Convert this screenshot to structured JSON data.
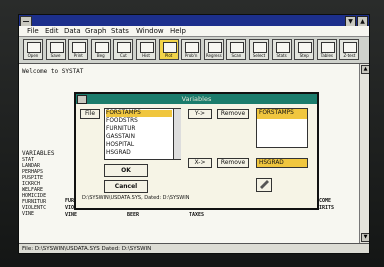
{
  "window": {
    "minimize_glyph": "▼",
    "maximize_glyph": "▲"
  },
  "menu": [
    "File",
    "Edit",
    "Data",
    "Graph",
    "Stats",
    "Window",
    "Help"
  ],
  "toolbar": [
    {
      "label": "Open"
    },
    {
      "label": "Save"
    },
    {
      "label": "Print"
    },
    {
      "label": "Beg"
    },
    {
      "label": "Cut"
    },
    {
      "label": "Hist"
    },
    {
      "label": "Plot"
    },
    {
      "label": "Prob'n"
    },
    {
      "label": "Regress"
    },
    {
      "label": "Scan"
    },
    {
      "label": "Select"
    },
    {
      "label": "Stats"
    },
    {
      "label": "Step"
    },
    {
      "label": "Tables"
    },
    {
      "label": "Z-test"
    }
  ],
  "toolbar_icons": [
    "open-icon",
    "save-icon",
    "print-icon",
    "begin-icon",
    "cut-icon",
    "histogram-icon",
    "scatter-plot-icon",
    "probability-icon",
    "regression-icon",
    "scan-icon",
    "select-icon",
    "statistics-icon",
    "step-icon",
    "tables-icon",
    "z-test-icon"
  ],
  "toolbar_active_index": 6,
  "main": {
    "welcome": "Welcome to SYSTAT",
    "variables_label": "VARIABLES",
    "left_vars": [
      "STAT",
      "LANDAR",
      "PERHAPS",
      "PUSPITE",
      "ICKRCH",
      "WELFARE",
      "HOMICIDE",
      "FURNITUR",
      "VIOLENTC",
      "VINE"
    ],
    "table_rows": [
      [
        "FURNITUR",
        "GASSTAIN",
        "HOSPITAL",
        "HSGRAD",
        "INCOME"
      ],
      [
        "VIOLENTC",
        "PROPERTY",
        "LOGNTS",
        "PRISONER",
        "SPIRITS"
      ],
      [
        "VINE",
        "BEER",
        "TAXES",
        "",
        ""
      ]
    ]
  },
  "dialog": {
    "title": "Variables",
    "file_button": "File",
    "source_items": [
      "FORSTAMPS",
      "FOODSTRS",
      "FURNITUR",
      "GASSTAIN",
      "HOSPITAL",
      "HSGRAD"
    ],
    "source_selected_index": 0,
    "y_button": "Y->",
    "x_button": "X->",
    "remove_button": "Remove",
    "y_value": "FORSTAMPS",
    "x_value": "HSGRAD",
    "ok_button": "OK",
    "cancel_button": "Cancel",
    "path": "D:\\SYSWIN\\USDATA.SYS, Dated: D:\\SYSWIN"
  },
  "status": "File: D:\\SYSWIN\\USDATA.SYS  Dated: D:\\SYSWIN"
}
